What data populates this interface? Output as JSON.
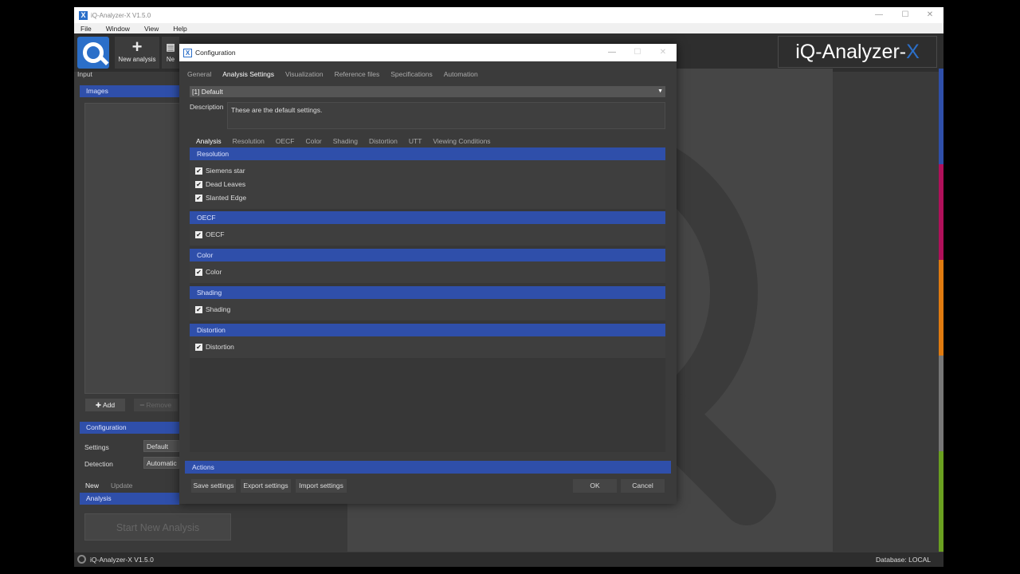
{
  "app": {
    "title": "iQ-Analyzer-X V1.5.0",
    "brand_main": "iQ-Analyzer-",
    "brand_x": "X",
    "menu": [
      "File",
      "Window",
      "View",
      "Help"
    ],
    "toolbar": {
      "new_analysis": "New analysis",
      "new_partial": "Ne"
    }
  },
  "left_panel": {
    "input_label": "Input",
    "images_header": "Images",
    "add_label": "Add",
    "remove_label": "Remove",
    "configuration_header": "Configuration",
    "settings_label": "Settings",
    "settings_value": "Default",
    "detection_label": "Detection",
    "detection_value": "Automatic",
    "tab_new": "New",
    "tab_update": "Update",
    "analysis_header": "Analysis",
    "start_button": "Start New Analysis"
  },
  "status": {
    "version": "iQ-Analyzer-X V1.5.0",
    "database": "Database: LOCAL"
  },
  "dialog": {
    "title": "Configuration",
    "top_tabs": [
      "General",
      "Analysis Settings",
      "Visualization",
      "Reference files",
      "Specifications",
      "Automation"
    ],
    "active_top_tab": "Analysis Settings",
    "profile": "[1] Default",
    "description_label": "Description",
    "description_text": "These are the default settings.",
    "sub_tabs": [
      "Analysis",
      "Resolution",
      "OECF",
      "Color",
      "Shading",
      "Distortion",
      "UTT",
      "Viewing Conditions"
    ],
    "active_sub_tab": "Analysis",
    "sections": [
      {
        "title": "Resolution",
        "items": [
          {
            "label": "Siemens star",
            "checked": true
          },
          {
            "label": "Dead Leaves",
            "checked": true
          },
          {
            "label": "Slanted Edge",
            "checked": true
          }
        ]
      },
      {
        "title": "OECF",
        "items": [
          {
            "label": "OECF",
            "checked": true
          }
        ]
      },
      {
        "title": "Color",
        "items": [
          {
            "label": "Color",
            "checked": true
          }
        ]
      },
      {
        "title": "Shading",
        "items": [
          {
            "label": "Shading",
            "checked": true
          }
        ]
      },
      {
        "title": "Distortion",
        "items": [
          {
            "label": "Distortion",
            "checked": true
          }
        ]
      }
    ],
    "actions_header": "Actions",
    "save_settings": "Save settings",
    "export_settings": "Export settings",
    "import_settings": "Import settings",
    "ok": "OK",
    "cancel": "Cancel"
  },
  "colors": {
    "section_blue": "#2f4faa",
    "brand_blue": "#2b6fc9",
    "strip": [
      "#2f4faa",
      "#b0105a",
      "#e07b10",
      "#777777",
      "#6aa020"
    ]
  }
}
